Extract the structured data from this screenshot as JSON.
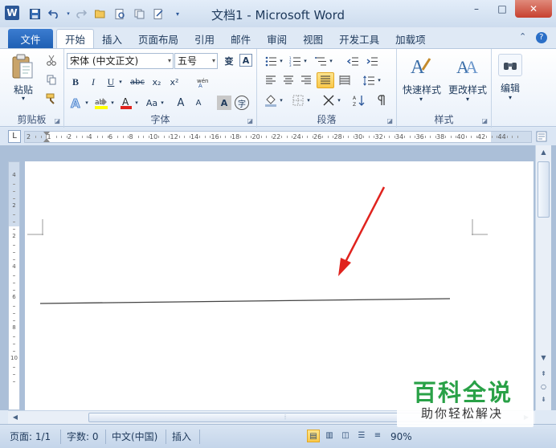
{
  "window": {
    "title": "文档1 - Microsoft Word",
    "app_logo": "W",
    "minimize": "–",
    "maximize": "□",
    "close": "✕"
  },
  "tabs": {
    "items": [
      {
        "label": "文件"
      },
      {
        "label": "开始"
      },
      {
        "label": "插入"
      },
      {
        "label": "页面布局"
      },
      {
        "label": "引用"
      },
      {
        "label": "邮件"
      },
      {
        "label": "审阅"
      },
      {
        "label": "视图"
      },
      {
        "label": "开发工具"
      },
      {
        "label": "加载项"
      }
    ],
    "active_index": 1
  },
  "ribbon": {
    "clipboard": {
      "label": "剪贴板",
      "paste": "粘贴"
    },
    "font": {
      "label": "字体",
      "font_name": "宋体 (中文正文)",
      "font_size": "五号",
      "change_case": "变",
      "bold": "B",
      "italic": "I",
      "underline": "U",
      "strike": "abc",
      "subscript": "x₂",
      "superscript": "x²",
      "grow": "A",
      "shrink": "A",
      "case": "Aa",
      "char_border": "A",
      "encircle": "字"
    },
    "paragraph": {
      "label": "段落"
    },
    "styles": {
      "label": "样式",
      "quick": "快速样式",
      "change": "更改样式"
    },
    "editing": {
      "label": "编辑"
    }
  },
  "ruler": {
    "corner": "L",
    "h_ticks": [
      "2",
      "1",
      "2",
      "4",
      "6",
      "8",
      "10",
      "12",
      "14",
      "16",
      "18",
      "20",
      "22",
      "24",
      "26",
      "28",
      "30",
      "32",
      "34",
      "36",
      "38",
      "40",
      "42",
      "44"
    ],
    "v_ticks": [
      "4",
      "2",
      "2",
      "4",
      "6",
      "8",
      "10"
    ]
  },
  "status": {
    "page": "页面: 1/1",
    "words": "字数: 0",
    "language": "中文(中国)",
    "insert_mode": "插入",
    "zoom": "90%"
  },
  "watermark": {
    "title": "百科全说",
    "subtitle": "助你轻松解决"
  },
  "colors": {
    "accent": "#2b579a",
    "annotation_arrow": "#e0231e",
    "watermark_green": "#29a147"
  }
}
